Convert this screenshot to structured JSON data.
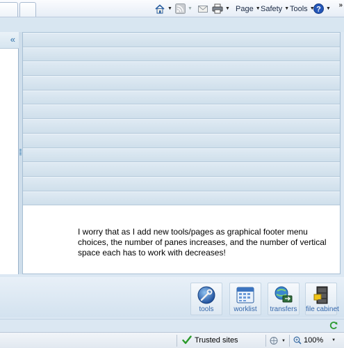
{
  "toolbar": {
    "home_icon": "home-icon",
    "feeds_icon": "rss-feed-icon",
    "mail_icon": "mail-icon",
    "print_icon": "printer-icon",
    "page_label": "Page",
    "safety_label": "Safety",
    "tools_label": "Tools",
    "help_icon": "help-icon",
    "overflow_label": "»"
  },
  "left_pane": {
    "collapse_label": "«"
  },
  "main": {
    "row_count": 12,
    "note": "I worry that as I add new tools/pages as graphical footer menu choices, the number of panes increases, and the number of vertical space each has to work with decreases!"
  },
  "footer_menu": [
    {
      "label": "tools",
      "icon": "tools-globe-icon"
    },
    {
      "label": "worklist",
      "icon": "calendar-icon"
    },
    {
      "label": "transfers",
      "icon": "transfers-icon"
    },
    {
      "label": "file cabinet",
      "icon": "file-cabinet-icon"
    }
  ],
  "status_bar": {
    "zone_label": "Trusted sites",
    "zoom_label": "100%"
  },
  "colors": {
    "accent": "#2f6fa8",
    "label_blue": "#3366aa",
    "row_bar": "#d3e2ee"
  }
}
